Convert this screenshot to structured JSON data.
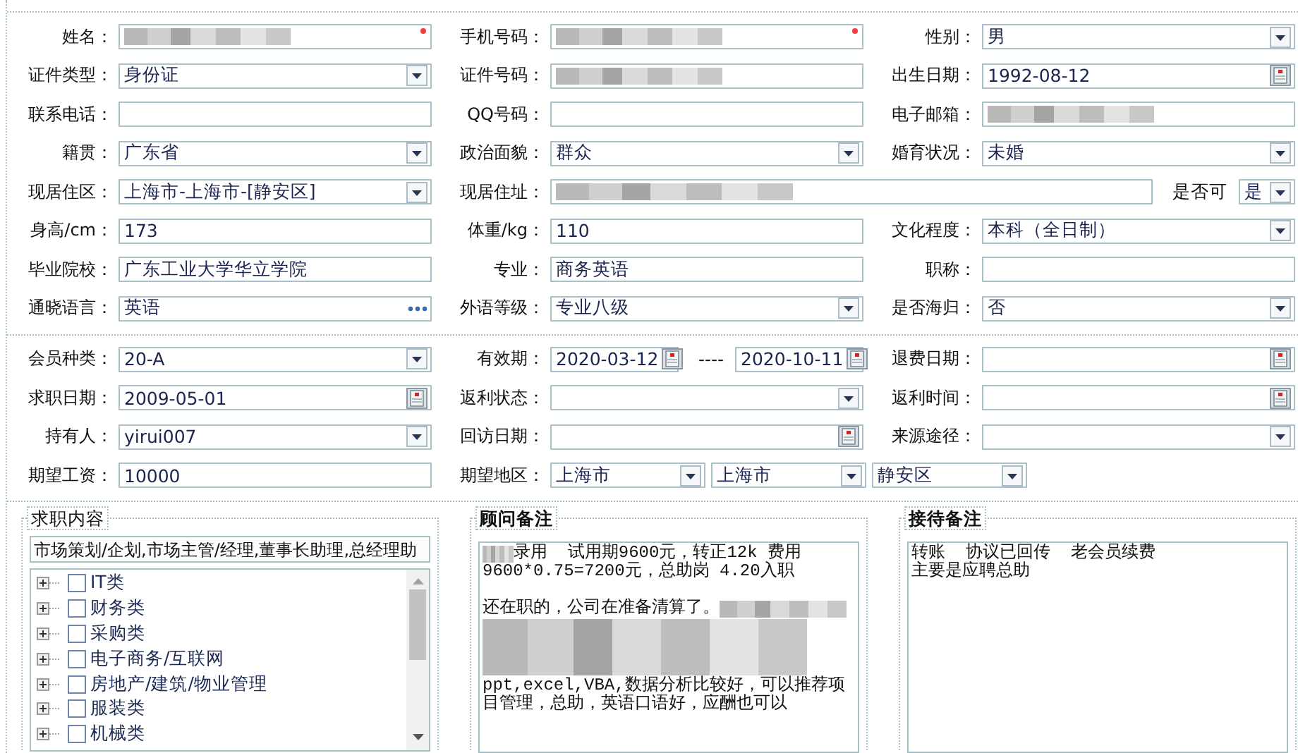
{
  "sections": [
    {
      "rows": [
        {
          "cells": [
            {
              "label": "姓名：",
              "required": true,
              "fields": [
                {
                  "kind": "redacted"
                }
              ]
            },
            {
              "label": "手机号码：",
              "required": true,
              "fields": [
                {
                  "kind": "redacted"
                }
              ]
            },
            {
              "label": "性别：",
              "required": false,
              "fields": [
                {
                  "kind": "select",
                  "value": "男"
                }
              ]
            }
          ]
        },
        {
          "cells": [
            {
              "label": "证件类型：",
              "required": false,
              "fields": [
                {
                  "kind": "select",
                  "value": "身份证"
                }
              ]
            },
            {
              "label": "证件号码：",
              "required": false,
              "fields": [
                {
                  "kind": "redacted"
                }
              ]
            },
            {
              "label": "出生日期：",
              "required": false,
              "fields": [
                {
                  "kind": "date",
                  "value": "1992-08-12"
                }
              ]
            }
          ]
        },
        {
          "cells": [
            {
              "label": "联系电话：",
              "required": false,
              "fields": [
                {
                  "kind": "text"
                }
              ]
            },
            {
              "label": "QQ号码：",
              "required": false,
              "fields": [
                {
                  "kind": "text"
                }
              ]
            },
            {
              "label": "电子邮箱：",
              "required": false,
              "fields": [
                {
                  "kind": "redacted"
                }
              ]
            }
          ]
        },
        {
          "cells": [
            {
              "label": "籍贯：",
              "required": false,
              "fields": [
                {
                  "kind": "select",
                  "value": "广东省"
                }
              ]
            },
            {
              "label": "政治面貌：",
              "required": false,
              "fields": [
                {
                  "kind": "select",
                  "value": "群众"
                }
              ]
            },
            {
              "label": "婚育状况：",
              "required": false,
              "fields": [
                {
                  "kind": "select",
                  "value": "未婚"
                }
              ]
            }
          ]
        },
        {
          "cells": [
            {
              "label": "现居住区：",
              "required": false,
              "fields": [
                {
                  "kind": "select",
                  "value": "上海市-上海市-[静安区]"
                }
              ]
            },
            {
              "label": "现居住址：",
              "required": false,
              "span": true,
              "fields": [
                {
                  "kind": "redacted"
                },
                {
                  "kind": "label",
                  "value": "是否可"
                },
                {
                  "kind": "select",
                  "value": "是",
                  "compact": true
                }
              ]
            }
          ]
        },
        {
          "cells": [
            {
              "label": "身高/cm：",
              "required": false,
              "fields": [
                {
                  "kind": "text",
                  "value": "173"
                }
              ]
            },
            {
              "label": "体重/kg：",
              "required": false,
              "fields": [
                {
                  "kind": "text",
                  "value": "110"
                }
              ]
            },
            {
              "label": "文化程度：",
              "required": false,
              "fields": [
                {
                  "kind": "select",
                  "value": "本科（全日制）"
                }
              ]
            }
          ]
        },
        {
          "cells": [
            {
              "label": "毕业院校：",
              "required": false,
              "fields": [
                {
                  "kind": "text",
                  "value": "广东工业大学华立学院"
                }
              ]
            },
            {
              "label": "专业：",
              "required": false,
              "fields": [
                {
                  "kind": "text",
                  "value": "商务英语"
                }
              ]
            },
            {
              "label": "职称：",
              "required": false,
              "fields": [
                {
                  "kind": "text"
                }
              ]
            }
          ]
        },
        {
          "cells": [
            {
              "label": "通晓语言：",
              "required": false,
              "fields": [
                {
                  "kind": "lookup",
                  "value": "英语"
                }
              ]
            },
            {
              "label": "外语等级：",
              "required": false,
              "fields": [
                {
                  "kind": "select",
                  "value": "专业八级"
                }
              ]
            },
            {
              "label": "是否海归：",
              "required": false,
              "fields": [
                {
                  "kind": "select",
                  "value": "否"
                }
              ]
            }
          ]
        }
      ]
    },
    {
      "rows": [
        {
          "cells": [
            {
              "label": "会员种类：",
              "required": false,
              "fields": [
                {
                  "kind": "select",
                  "value": "20-A"
                }
              ]
            },
            {
              "label": "有效期：",
              "required": false,
              "fields": [
                {
                  "kind": "date",
                  "value": "2020-03-12"
                },
                {
                  "kind": "label",
                  "value": "----"
                },
                {
                  "kind": "date",
                  "value": "2020-10-11"
                }
              ]
            },
            {
              "label": "退费日期：",
              "required": false,
              "fields": [
                {
                  "kind": "date"
                }
              ]
            }
          ]
        },
        {
          "cells": [
            {
              "label": "求职日期：",
              "required": false,
              "fields": [
                {
                  "kind": "date",
                  "value": "2009-05-01"
                }
              ]
            },
            {
              "label": "返利状态：",
              "required": false,
              "fields": [
                {
                  "kind": "select"
                }
              ]
            },
            {
              "label": "返利时间：",
              "required": false,
              "fields": [
                {
                  "kind": "date"
                }
              ]
            }
          ]
        },
        {
          "cells": [
            {
              "label": "持有人：",
              "required": false,
              "fields": [
                {
                  "kind": "select",
                  "value": "yirui007"
                }
              ]
            },
            {
              "label": "回访日期：",
              "required": false,
              "fields": [
                {
                  "kind": "date"
                }
              ]
            },
            {
              "label": "来源途径：",
              "required": false,
              "fields": [
                {
                  "kind": "select"
                }
              ]
            }
          ]
        },
        {
          "cells": [
            {
              "label": "期望工资：",
              "required": false,
              "fields": [
                {
                  "kind": "text",
                  "value": "10000"
                }
              ]
            },
            {
              "label": "期望地区：",
              "required": false,
              "span": true,
              "fields": [
                {
                  "kind": "select",
                  "value": "上海市"
                },
                {
                  "kind": "select",
                  "value": "上海市"
                },
                {
                  "kind": "select",
                  "value": "静安区"
                }
              ]
            }
          ]
        }
      ]
    }
  ],
  "job_panel": {
    "title": "求职内容",
    "summary": "市场策划/企划,市场主管/经理,董事长助理,总经理助",
    "items": [
      {
        "label": "IT类",
        "checked": false,
        "expanded": false
      },
      {
        "label": "财务类",
        "checked": false,
        "expanded": false
      },
      {
        "label": "采购类",
        "checked": false,
        "expanded": false
      },
      {
        "label": "电子商务/互联网",
        "checked": false,
        "expanded": false
      },
      {
        "label": "房地产/建筑/物业管理",
        "checked": false,
        "expanded": false
      },
      {
        "label": "服装类",
        "checked": false,
        "expanded": false
      },
      {
        "label": "机械类",
        "checked": false,
        "expanded": false
      }
    ]
  },
  "notes": [
    {
      "title": "顾问备注",
      "lines": [
        {
          "kind": "text",
          "text": "录用  试用期9600元，转正12k 费用",
          "redacted_before": true,
          "redacted_after": false
        },
        {
          "kind": "text",
          "text": "9600*0.75=7200元，总助岗 4.20入职",
          "redacted_before": false,
          "redacted_after": false
        },
        {
          "kind": "blank"
        },
        {
          "kind": "text",
          "text": "还在职的，公司在准备清算了。",
          "redacted_before": false,
          "redacted_after": true
        },
        {
          "kind": "redacted"
        },
        {
          "kind": "text",
          "text": "ppt,excel,VBA,数据分析比较好，可以推荐项目管理，总助，英语口语好，应酬也可以",
          "redacted_before": false,
          "redacted_after": false
        }
      ]
    },
    {
      "title": "接待备注",
      "lines": [
        {
          "kind": "text",
          "text": "转账  协议已回传  老会员续费",
          "redacted_before": false,
          "redacted_after": false
        },
        {
          "kind": "text",
          "text": "主要是应聘总助",
          "redacted_before": false,
          "redacted_after": false
        }
      ]
    }
  ]
}
